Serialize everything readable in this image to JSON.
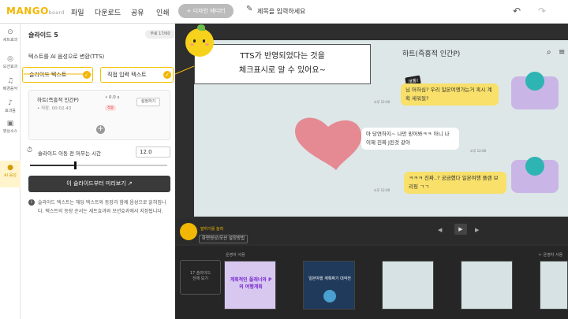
{
  "header": {
    "logo": "MANGO",
    "logo_sub": "board",
    "menus": [
      "파일",
      "다운로드",
      "공유",
      "인쇄"
    ],
    "design_editor": "+ 디자인 에디터",
    "title_placeholder": "제목을 입력하세요"
  },
  "leftnav": [
    "세트효과",
    "모션효과",
    "배경음악",
    "효과음",
    "영상소스",
    "AI 음성"
  ],
  "panel": {
    "slide_title": "슬라이드 5",
    "badge": "무료 17/60",
    "section_label": "텍스트를 AI 음성으로 변환(TTS)",
    "tab_slide_text": "슬라이드 텍스트",
    "tab_direct_text": "직접 입력 텍스트",
    "voice_name": "하트(즉흥적 인간P)",
    "voice_sub": "• 저장, 00:02.43",
    "speed": "• 0.0 s",
    "red_pill": "적용",
    "ver_button": "설정하기",
    "dwell_label": "슬라이드 이동 전 머무는 시간",
    "dwell_value": "12.0",
    "preview_button": "이 슬라이드부터 미리보기",
    "notice": "슬라이드 텍스트는 해당 텍스트와 등장과 함께 음성으로 읽혀집니다. 텍스트의 등장 순서는 세트효과와 모션효과에서 지정됩니다."
  },
  "callout": {
    "line1": "TTS가 반영되었다는 것을",
    "line2": "체크표시로 알 수 있어요~"
  },
  "canvas": {
    "chat_title": "하트(즉흥적 인간P)",
    "sticker": "개통!",
    "bubble1": "님 머하심? 우리 일본여행가는거 혹시 계획 세워뒀?",
    "bubble2": "아 당연하지~ 나만 믿어봐ㅋㅋ 아니 나 이제 진짜 J된것 같아",
    "bubble3": "ㅋㅋㅋ 진짜..? 궁금했다 일본여행 플랜 브리핑 ㄱㄱ",
    "time1": "오후 12:00",
    "time2": "오후 12:00",
    "time3": "오후 12:00"
  },
  "bottom": {
    "hint_top": "말하기를 눌러",
    "hint_button": "화면영상/모션 설정방법",
    "timeline_label1": "운영자 사용",
    "timeline_label2": "＋ 운영자 사용",
    "thumb_side": "17 슬라이드\n전체 보기",
    "thumb1_title": "계획적인 플래너와 P의 여행계획",
    "thumb2_title": "일본여행 계획짜기 대작전"
  },
  "colors": {
    "accent": "#f2b705",
    "dark": "#2e2e2e"
  }
}
